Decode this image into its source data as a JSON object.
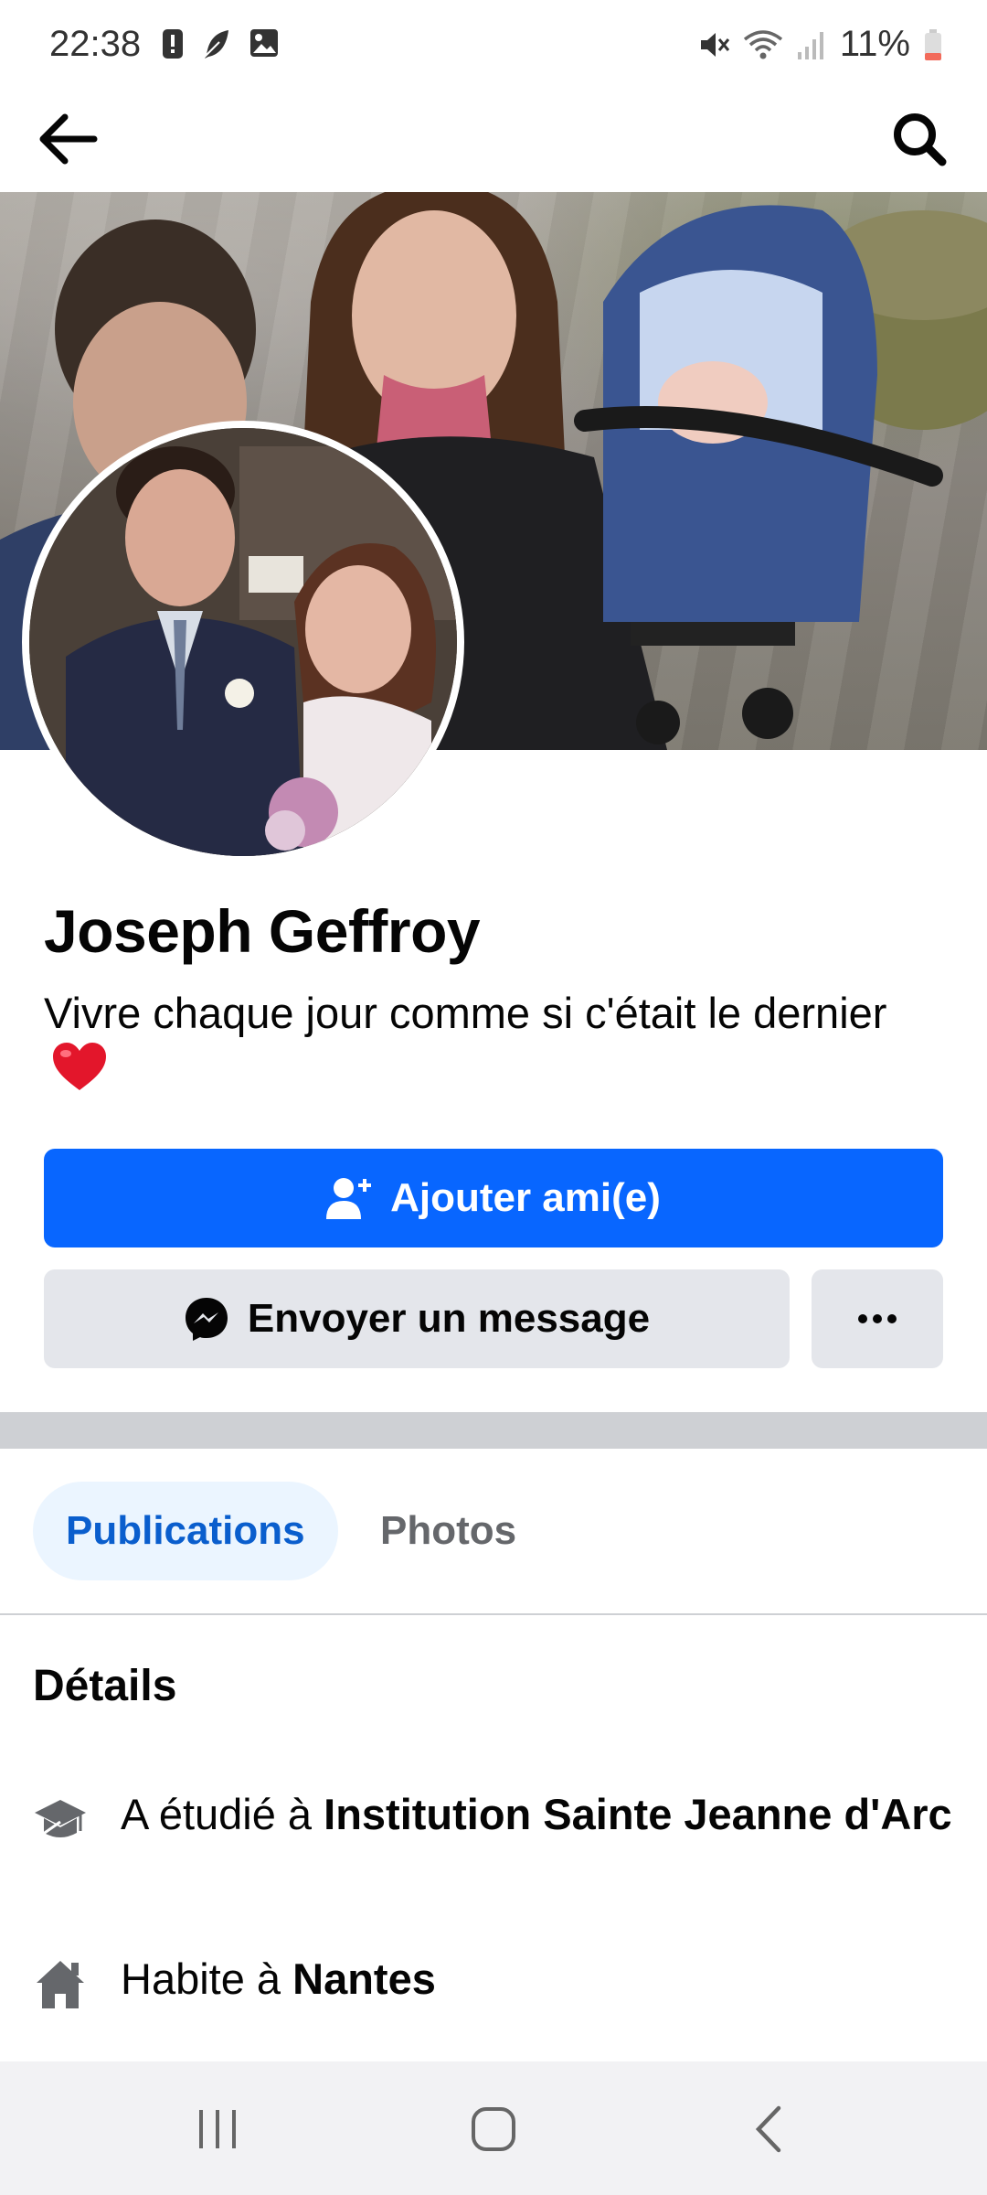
{
  "status_bar": {
    "time": "22:38",
    "battery": "11%"
  },
  "top_nav": {
    "back_icon": "back-arrow-icon",
    "search_icon": "search-icon"
  },
  "profile": {
    "name": "Joseph Geffroy",
    "bio": "Vivre chaque jour comme si c'était le dernier",
    "bio_emoji": "❤️"
  },
  "actions": {
    "add_friend_label": "Ajouter ami(e)",
    "send_message_label": "Envoyer un message",
    "more_label": "•••"
  },
  "tabs": [
    {
      "label": "Publications",
      "active": true
    },
    {
      "label": "Photos",
      "active": false
    }
  ],
  "details": {
    "title": "Détails",
    "items": [
      {
        "icon": "graduation-cap-icon",
        "prefix": "A étudié à ",
        "value": "Institution Sainte Jeanne d'Arc"
      },
      {
        "icon": "home-icon",
        "prefix": "Habite à ",
        "value": "Nantes"
      }
    ]
  },
  "colors": {
    "primary_blue": "#0866ff",
    "secondary_button": "#e4e6eb",
    "active_tab_bg": "#ebf5ff",
    "active_tab_text": "#0a5ecd"
  }
}
